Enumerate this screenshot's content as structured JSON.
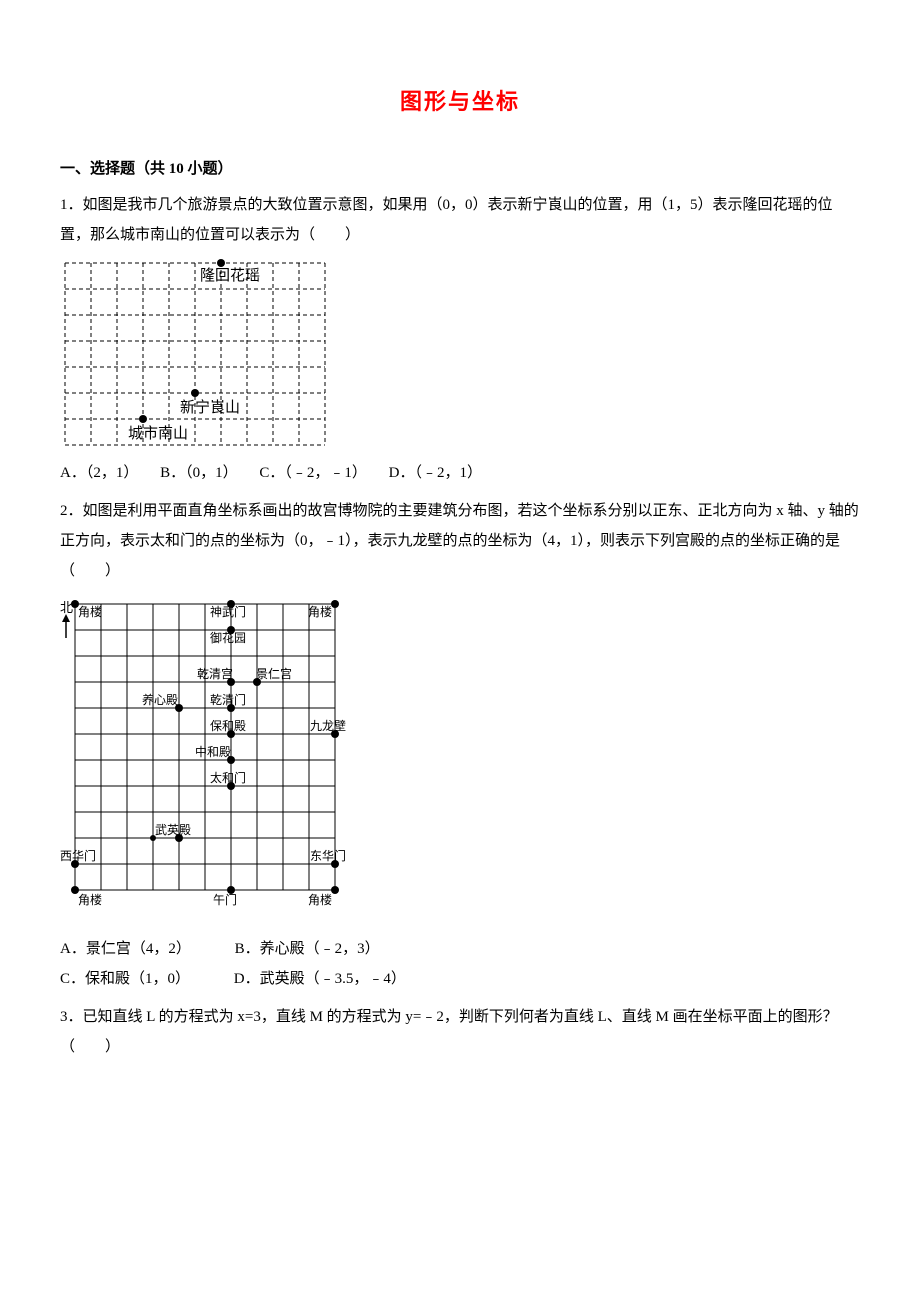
{
  "title": "图形与坐标",
  "section1": {
    "heading": "一、选择题（共 10 小题）"
  },
  "q1": {
    "text": "1．如图是我市几个旅游景点的大致位置示意图，如果用（0，0）表示新宁崀山的位置，用（1，5）表示隆回花瑶的位置，那么城市南山的位置可以表示为（　　）",
    "optA": "A．（2，1）",
    "optB": "B．（0，1）",
    "optC": "C．（﹣2，﹣1）",
    "optD": "D．（﹣2，1）",
    "fig": {
      "label_huayao": "隆回花瑶",
      "label_langshan": "新宁崀山",
      "label_nanshan": "城市南山"
    }
  },
  "q2": {
    "text": "2．如图是利用平面直角坐标系画出的故宫博物院的主要建筑分布图，若这个坐标系分别以正东、正北方向为 x 轴、y 轴的正方向，表示太和门的点的坐标为（0，﹣1），表示九龙壁的点的坐标为（4，1），则表示下列宫殿的点的坐标正确的是（　　）",
    "optA": "A．景仁宫（4，2）",
    "optB": "B．养心殿（﹣2，3）",
    "optC": "C．保和殿（1，0）",
    "optD": "D．武英殿（﹣3.5，﹣4）",
    "fig": {
      "north": "北",
      "jiaolou": "角楼",
      "shenwumen": "神武门",
      "yuhuayuan": "御花园",
      "qianqinggong": "乾清宫",
      "jingrengong": "景仁宫",
      "yangxindian": "养心殿",
      "qianqingmen": "乾清门",
      "baohedian": "保和殿",
      "jiulongbi": "九龙壁",
      "zhonghedian": "中和殿",
      "taihemen": "太和门",
      "wuyingdian": "武英殿",
      "xihuamen": "西华门",
      "donghuamen": "东华门",
      "wumen": "午门"
    }
  },
  "q3": {
    "text": "3．已知直线 L 的方程式为 x=3，直线 M 的方程式为 y=﹣2，判断下列何者为直线 L、直线 M 画在坐标平面上的图形？（　　）"
  }
}
